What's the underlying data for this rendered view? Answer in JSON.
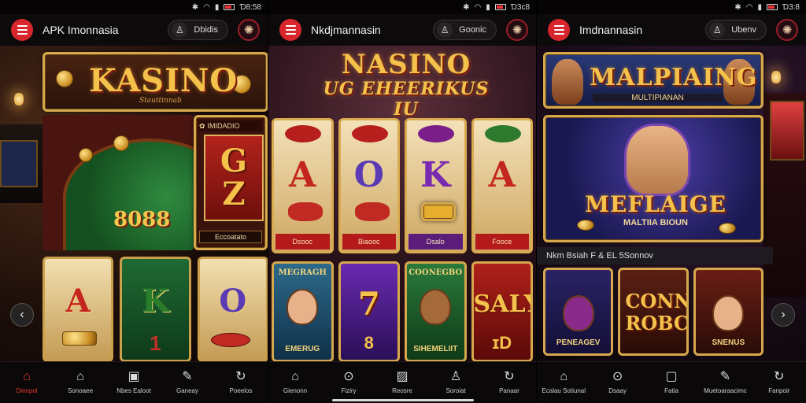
{
  "colors": {
    "accent": "#d8262c",
    "gold": "#d7a84b",
    "background": "#0b0608"
  },
  "screens": [
    {
      "status": {
        "time": "Ɗ8:58",
        "icons": [
          "bluetooth-icon",
          "wifi-icon",
          "signal-icon",
          "battery-icon"
        ]
      },
      "appbar": {
        "title": "APK Imonnasia",
        "pill_label": "Dbidis"
      },
      "banner": {
        "title": "KASINO",
        "subtitle": "Stauttinnab"
      },
      "table": {
        "number": "8088"
      },
      "card": {
        "header": "IMIDADIO",
        "face_top": "G",
        "face_bottom": "Z",
        "footer": "Eccoatato"
      },
      "reels": [
        {
          "symbol": "A"
        },
        {
          "symbol": "K",
          "below": "1"
        },
        {
          "symbol": "O"
        }
      ],
      "nav": [
        {
          "label": "Dienpol",
          "icon": "home-icon",
          "active": true
        },
        {
          "label": "Sonoaee",
          "icon": "house-icon"
        },
        {
          "label": "Nbes Ealoot",
          "icon": "cards-icon"
        },
        {
          "label": "Ganeay",
          "icon": "edit-icon"
        },
        {
          "label": "Poeelos",
          "icon": "refresh-icon"
        }
      ]
    },
    {
      "status": {
        "time": "Ɗ3c8",
        "icons": [
          "bluetooth-icon",
          "wifi-icon",
          "signal-icon",
          "battery-icon"
        ]
      },
      "appbar": {
        "title": "Nkdjmannasin",
        "pill_label": "Goonic"
      },
      "banner": {
        "line1": "NASINO",
        "line2": "UG EHEERIKUS IU"
      },
      "tiles": [
        {
          "letter": "A",
          "footer": "Dsooc"
        },
        {
          "letter": "O",
          "footer": "Biaooc"
        },
        {
          "letter": "K",
          "footer": "Dsalo"
        },
        {
          "letter": "A",
          "footer": "Fooce"
        }
      ],
      "cards": [
        {
          "title": "MEGRAGH",
          "label": "EMERUG"
        },
        {
          "big": "7",
          "sub": "8"
        },
        {
          "title": "COONEGBO",
          "label": "SIHEMELIIT"
        },
        {
          "big": "SALY",
          "sub": "ɪD"
        }
      ],
      "nav": [
        {
          "label": "Gienonn",
          "icon": "house-icon"
        },
        {
          "label": "Fiziry",
          "icon": "search-icon"
        },
        {
          "label": "Reosre",
          "icon": "image-icon"
        },
        {
          "label": "Soroiat",
          "icon": "user-icon"
        },
        {
          "label": "Panaar",
          "icon": "refresh-icon"
        }
      ]
    },
    {
      "status": {
        "time": "Ɗ3:8",
        "icons": [
          "bluetooth-icon",
          "wifi-icon",
          "signal-icon",
          "battery-icon"
        ]
      },
      "appbar": {
        "title": "Imdnannasin",
        "pill_label": "Ubenv"
      },
      "banner": {
        "title": "MALPIAING",
        "subtitle": "MULTIPIANAN"
      },
      "hero": {
        "title": "MEFLAIGE",
        "subtitle": "MALTIIA BIOUN"
      },
      "strip": "Nkm Bsiah F & EL 5Sonnov",
      "cards": [
        {
          "label": "PENEAGEV"
        },
        {
          "big": "CONN ROBCS"
        },
        {
          "label": "SNENUS"
        }
      ],
      "nav": [
        {
          "label": "Ecalau Sotiunal",
          "icon": "house-icon"
        },
        {
          "label": "Dsaay",
          "icon": "search-icon"
        },
        {
          "label": "Fatia",
          "icon": "chat-icon"
        },
        {
          "label": "Muetoaraacimc",
          "icon": "edit-icon"
        },
        {
          "label": "Fanpoir",
          "icon": "refresh-icon"
        }
      ]
    }
  ]
}
